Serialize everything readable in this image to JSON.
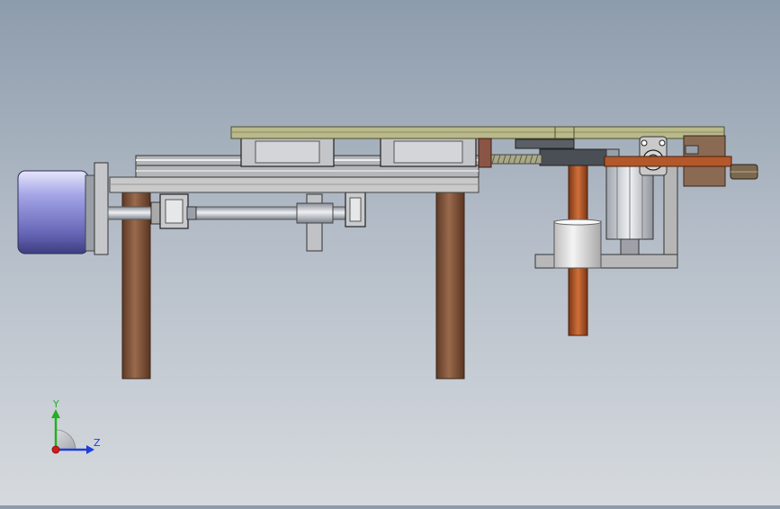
{
  "triad": {
    "y_label": "Y",
    "z_label": "Z",
    "colors": {
      "y_axis": "#22b022",
      "z_axis": "#1d3fd6",
      "x_axis": "#d21a1a"
    }
  },
  "colors": {
    "background_top": "#8d9cac",
    "background_bottom": "#d6dade",
    "plate": "#b9b98a",
    "legs": "#7e5238",
    "motor": "#9a9ad8",
    "frame_gray": "#b7b7b7",
    "rod_copper": "#b3582a"
  }
}
